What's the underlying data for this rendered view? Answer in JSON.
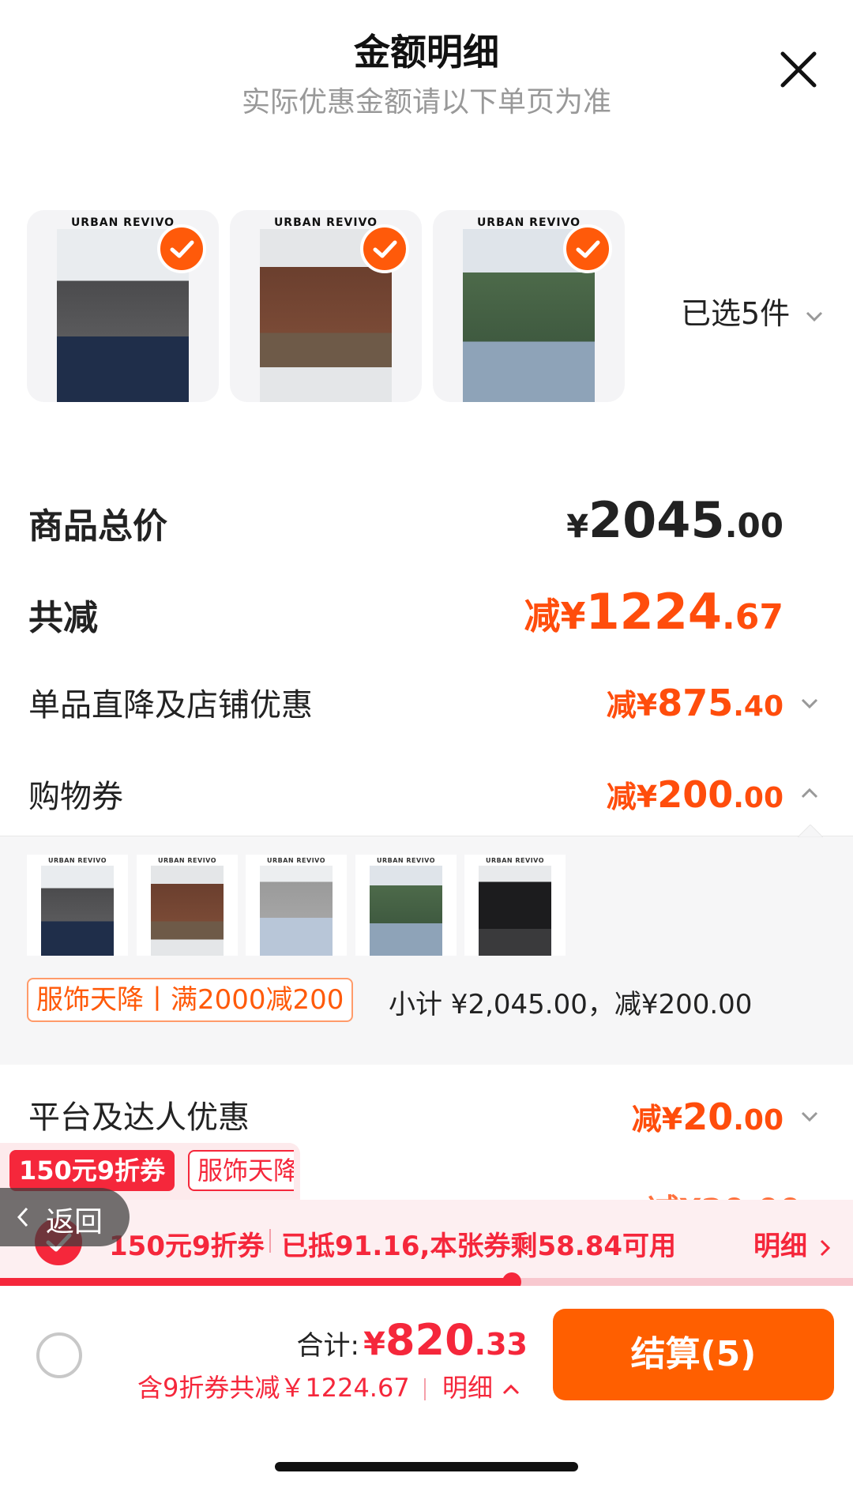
{
  "header": {
    "title": "金额明细",
    "subtitle": "实际优惠金额请以下单页为准"
  },
  "selected_items": {
    "thumbnails": [
      {
        "brand": "URBAN REVIVO"
      },
      {
        "brand": "URBAN REVIVO"
      },
      {
        "brand": "URBAN REVIVO"
      }
    ],
    "count_label": "已选5件"
  },
  "summary": {
    "total_label": "商品总价",
    "total_symbol": "¥",
    "total_int": "2045",
    "total_dec": ".00",
    "discount_label": "共减",
    "discount_prefix": "减¥",
    "discount_int": "1224",
    "discount_dec": ".67"
  },
  "breakdown": [
    {
      "label": "单品直降及店铺优惠",
      "prefix": "减¥",
      "int": "875",
      "dec": ".40",
      "expanded": false
    },
    {
      "label": "购物券",
      "prefix": "减¥",
      "int": "200",
      "dec": ".00",
      "expanded": true
    },
    {
      "label": "平台及达人优惠",
      "prefix": "减¥",
      "int": "20",
      "dec": ".00",
      "expanded": false
    }
  ],
  "coupon_detail": {
    "thumbnails": [
      {
        "brand": "URBAN REVIVO"
      },
      {
        "brand": "URBAN REVIVO"
      },
      {
        "brand": "URBAN REVIVO"
      },
      {
        "brand": "URBAN REVIVO"
      },
      {
        "brand": "URBAN REVIVO"
      }
    ],
    "tag": "服饰天降丨满2000减200",
    "summary": "小计 ¥2,045.00，减¥200.00"
  },
  "overlay": {
    "badge_red": "150元9折券",
    "badge_outline": "服饰天降",
    "back_label": "返回",
    "hidden_amount": "减¥20.00"
  },
  "promo_bar": {
    "coupon_name": "150元9折券",
    "coupon_desc": "已抵91.16,本张券剩58.84可用",
    "detail_link": "明细",
    "progress": 0.6
  },
  "footer": {
    "total_label": "合计:",
    "total_symbol": "¥",
    "total_int": "820",
    "total_dec": ".33",
    "savings_text": "含9折券共减￥1224.67",
    "detail_link": "明细",
    "checkout_label": "结算(5)"
  },
  "colors": {
    "accent_orange": "#ff5a0a",
    "accent_red": "#f5273b",
    "checkout_bg": "#ff5f00"
  }
}
